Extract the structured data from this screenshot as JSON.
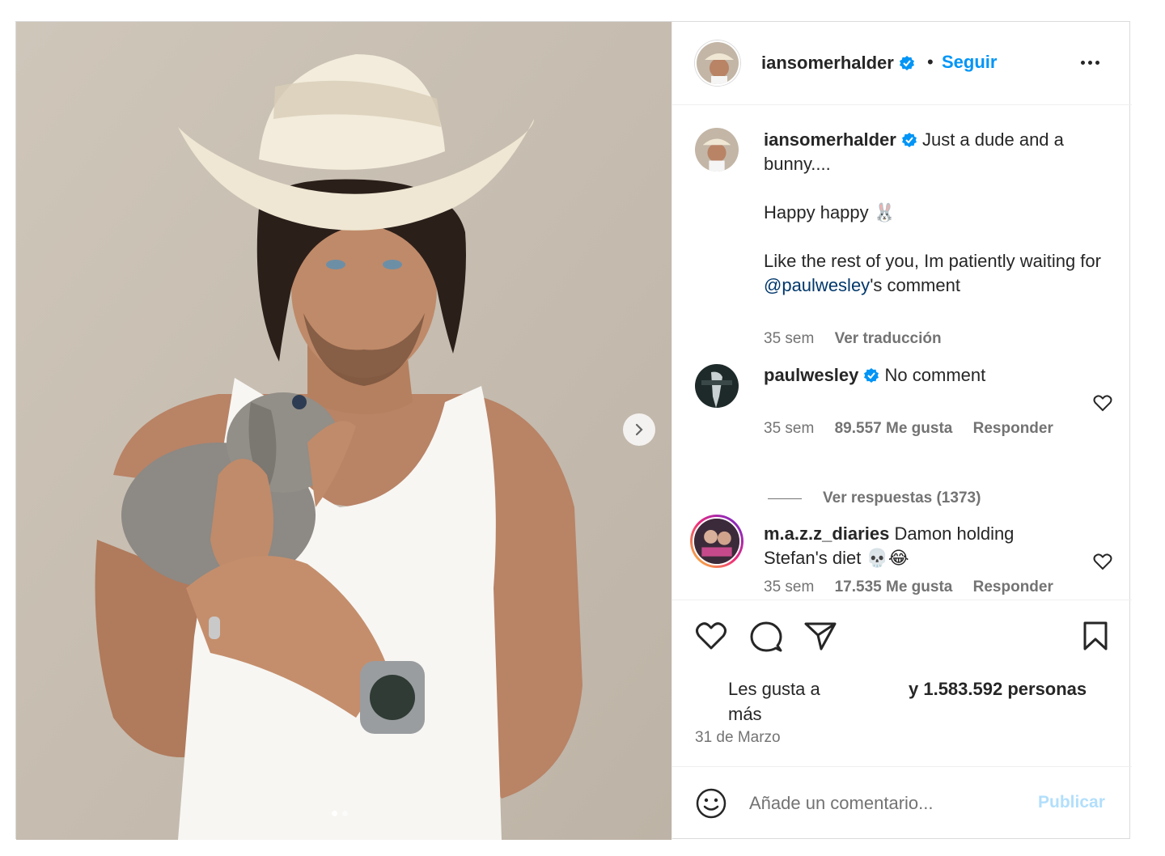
{
  "post": {
    "photo": {
      "alt": "Man in cowboy hat and white tank top holding a gray bunny",
      "carousel_index": 1,
      "carousel_count": 2
    },
    "author": {
      "username": "iansomerhalder",
      "verified": true,
      "follow_label": "Seguir",
      "bullet": "•"
    },
    "caption": {
      "username": "iansomerhalder",
      "lines": [
        "Just a dude and a bunny....",
        "Happy happy 🐰",
        "Like the rest of you, Im patiently waiting for "
      ],
      "mention": "@paulwesley",
      "mention_suffix": "'s comment",
      "time": "35 sem",
      "translate_label": "Ver traducción"
    },
    "comments": [
      {
        "username": "paulwesley",
        "verified": true,
        "text": "No comment",
        "time": "35 sem",
        "likes": "89.557 Me gusta",
        "reply_label": "Responder",
        "view_replies": "Ver respuestas (1373)"
      },
      {
        "username": "m.a.z.z_diaries",
        "verified": false,
        "text": "Damon holding Stefan's diet 💀😂",
        "time": "35 sem",
        "likes": "17.535 Me gusta",
        "reply_label": "Responder"
      }
    ],
    "likes_text_a": "Les gusta a más",
    "likes_text_b": "y 1.583.592 personas",
    "date": "31 de Marzo",
    "add_comment": {
      "placeholder": "Añade un comentario...",
      "publish_label": "Publicar"
    },
    "colors": {
      "accent": "#0095f6",
      "mention": "#00376b",
      "muted": "#737373",
      "publish_disabled": "#b2dffc",
      "verified": "#0095f6"
    }
  }
}
